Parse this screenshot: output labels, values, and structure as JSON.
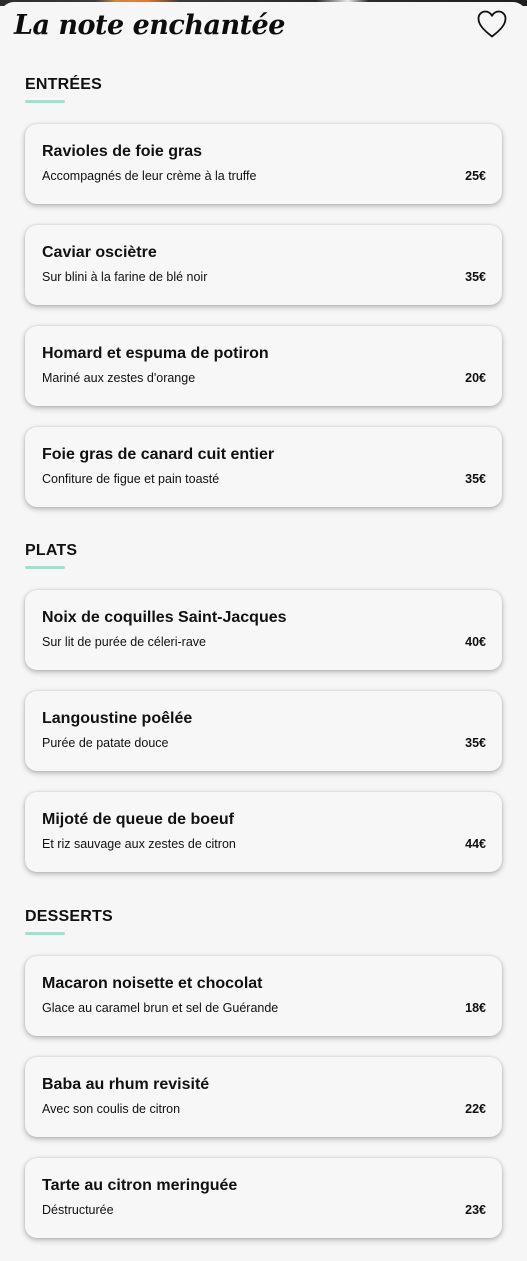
{
  "app": {
    "title": "La note enchantée"
  },
  "sections": [
    {
      "title": "ENTRÉES",
      "items": [
        {
          "name": "Ravioles de foie gras",
          "description": "Accompagnés de leur crème à la truffe",
          "price": "25€"
        },
        {
          "name": "Caviar osciètre",
          "description": "Sur blini à la farine de blé noir",
          "price": "35€"
        },
        {
          "name": "Homard et espuma de potiron",
          "description": "Mariné aux zestes d'orange",
          "price": "20€"
        },
        {
          "name": "Foie gras de canard cuit entier",
          "description": "Confiture de figue et pain toasté",
          "price": "35€"
        }
      ]
    },
    {
      "title": "PLATS",
      "items": [
        {
          "name": "Noix de coquilles Saint-Jacques",
          "description": "Sur lit de purée de céleri-rave",
          "price": "40€"
        },
        {
          "name": "Langoustine poêlée",
          "description": "Purée de patate douce",
          "price": "35€"
        },
        {
          "name": "Mijoté de queue de boeuf",
          "description": "Et riz sauvage aux zestes de citron",
          "price": "44€"
        }
      ]
    },
    {
      "title": "DESSERTS",
      "items": [
        {
          "name": "Macaron noisette et chocolat",
          "description": "Glace au caramel brun et sel de Guérande",
          "price": "18€"
        },
        {
          "name": "Baba au rhum revisité",
          "description": "Avec son coulis de citron",
          "price": "22€"
        },
        {
          "name": "Tarte au citron meringuée",
          "description": "Déstructurée",
          "price": "23€"
        }
      ]
    }
  ],
  "colors": {
    "accent_underline": "#9be3cf",
    "background": "#f6f6f6",
    "card": "#f7f7f7"
  },
  "icons": {
    "favorite": "heart-outline-icon"
  }
}
